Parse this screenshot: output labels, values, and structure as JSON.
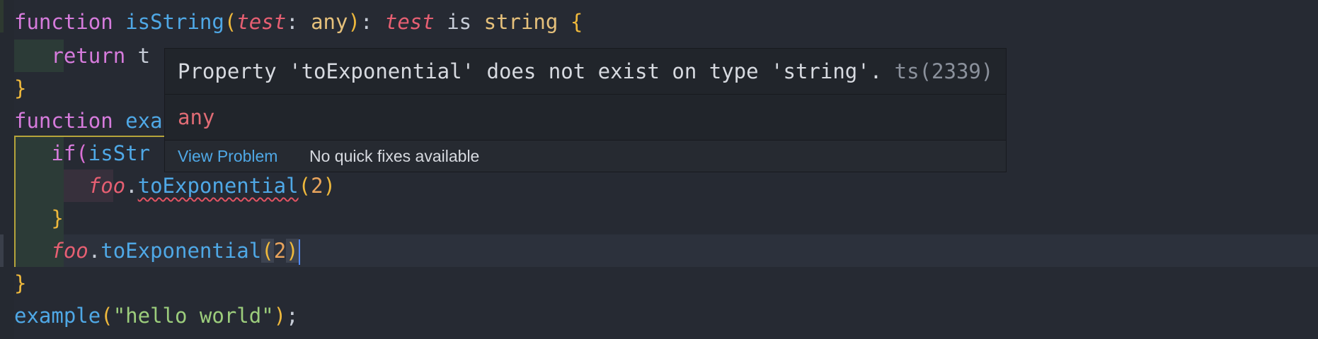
{
  "code": {
    "l1": {
      "kw": "function",
      "name": "isString",
      "open": "(",
      "param": "test",
      "colon": ":",
      "type": "any",
      "close": ")",
      "colon2": ":",
      "param2": "test",
      "is": "is",
      "type2": "string",
      "brace": "{"
    },
    "l2": {
      "kw": "return",
      "rest": "t"
    },
    "l3": {
      "brace": "}"
    },
    "l4": {
      "kw": "function",
      "name": "exa"
    },
    "l5": {
      "kw": "if",
      "open": "(",
      "name": "isStr"
    },
    "l6": {
      "obj": "foo",
      "dot": ".",
      "method": "toExponential",
      "open": "(",
      "arg": "2",
      "close": ")"
    },
    "l7": {
      "brace": "}"
    },
    "l8": {
      "obj": "foo",
      "dot": ".",
      "method": "toExponential",
      "open": "(",
      "arg": "2",
      "close": ")"
    },
    "l9": {
      "brace": "}"
    },
    "l10": {
      "name": "example",
      "open": "(",
      "str": "\"hello world\"",
      "close": ")",
      "semi": ";"
    }
  },
  "hover": {
    "message": "Property 'toExponential' does not exist on type 'string'.",
    "code": "ts(2339)",
    "type": "any",
    "view_problem": "View Problem",
    "no_fixes": "No quick fixes available"
  },
  "colors": {
    "keyword": "#d67bdc",
    "function": "#4fa8e6",
    "param": "#e65f72",
    "type": "#e5c07b",
    "string": "#9ccd7c",
    "number": "#e8a35c",
    "background": "#262a33",
    "error_underline": "#e15363"
  }
}
